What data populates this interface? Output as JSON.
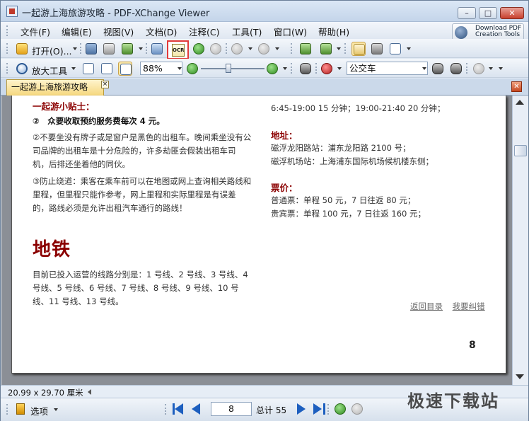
{
  "window": {
    "title": "一起游上海旅游攻略 - PDF-XChange Viewer"
  },
  "menu": [
    "文件(F)",
    "编辑(E)",
    "视图(V)",
    "文档(D)",
    "注释(C)",
    "工具(T)",
    "窗口(W)",
    "帮助(H)"
  ],
  "download_pdf": "Download PDF\nCreation Tools",
  "toolbar": {
    "open_label": "打开(O)...",
    "ocr_label": "OCR",
    "zoom_tool_label": "放大工具",
    "zoom_value": "88%",
    "search_value": "公交车"
  },
  "tab": {
    "label": "一起游上海旅游攻略",
    "close": "×"
  },
  "document": {
    "tip_title": "一起游小贴士：",
    "tip1": "②　众要收取预约服务费每次 4 元。",
    "tip2": "②不要坐没有牌子或是窗户是黑色的出租车。晚间乘坐没有公司品牌的出租车是十分危险的，许多劫匪会假装出租车司机，后排还坐着他的同伙。",
    "tip3": "③防止绕道：乘客在乘车前可以在地图或网上查询相关路线和里程，但里程只能作参考，网上里程和实际里程是有误差的，路线必须是允许出租汽车通行的路线！",
    "metro_heading": "地铁",
    "metro_text": "目前已投入运营的线路分别是：1 号线、2 号线、3 号线、4 号线、5 号线、6 号线、7 号线、8 号线、9 号线、10 号线、11 号线、13 号线。",
    "hours": "6:45-19:00 15 分钟；19:00-21:40 20 分钟；",
    "address_heading": "地址：",
    "address1": "磁浮龙阳路站：浦东龙阳路 2100 号；",
    "address2": "磁浮机场站：上海浦东国际机场候机楼东侧；",
    "fare_heading": "票价：",
    "fare1": "普通票：单程 50 元，7 日往返 80 元；",
    "fare2": "贵宾票：单程 100 元，7 日往返 160 元；",
    "link_back": "返回目录",
    "link_report": "我要纠错",
    "page_number": "8"
  },
  "status": {
    "page_size": "20.99 x 29.70 厘米",
    "options_label": "选项",
    "current_page": "8",
    "total_pages": "总计 55",
    "watermark": "极速下载站"
  }
}
